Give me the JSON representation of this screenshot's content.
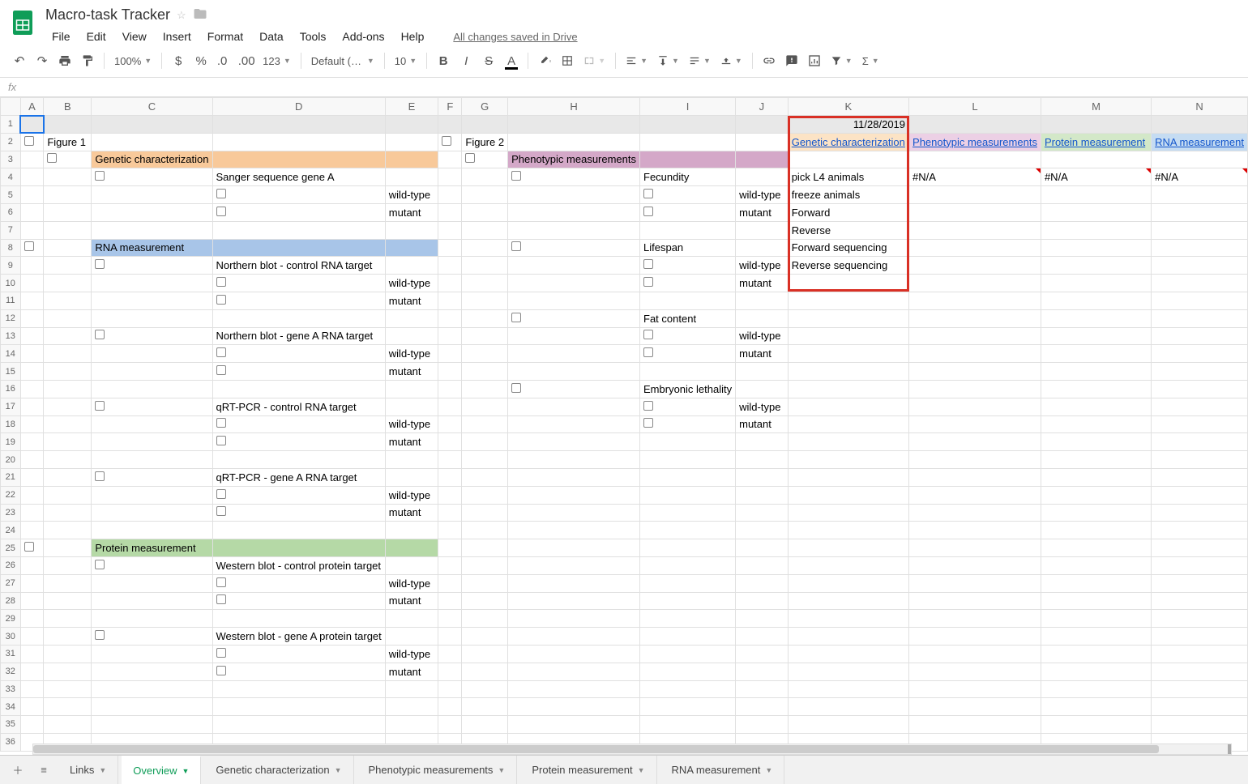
{
  "header": {
    "title": "Macro-task Tracker",
    "save_status": "All changes saved in Drive"
  },
  "menubar": [
    "File",
    "Edit",
    "View",
    "Insert",
    "Format",
    "Data",
    "Tools",
    "Add-ons",
    "Help"
  ],
  "toolbar": {
    "zoom": "100%",
    "font": "Default (Ari...",
    "font_size": "10"
  },
  "formula_bar": {
    "fx": "fx",
    "value": ""
  },
  "columns": [
    "A",
    "B",
    "C",
    "D",
    "E",
    "F",
    "G",
    "H",
    "I",
    "J",
    "K",
    "L",
    "M",
    "N"
  ],
  "sheet": {
    "row1": {
      "K": "11/28/2019"
    },
    "row2": {
      "B": "Figure 1",
      "G": "Figure 2",
      "K": "Genetic characterization",
      "L": "Phenotypic measurements",
      "M": "Protein measurement",
      "N": "RNA measurement"
    },
    "row3": {
      "C": "Genetic characterization",
      "H": "Phenotypic measurements"
    },
    "row4": {
      "D": "Sanger sequence gene A",
      "I": "Fecundity",
      "K": "pick L4 animals",
      "L": "#N/A",
      "M": "#N/A",
      "N": "#N/A"
    },
    "row5": {
      "E": "wild-type",
      "J": "wild-type",
      "K": "freeze animals"
    },
    "row6": {
      "E": "mutant",
      "J": "mutant",
      "K": "Forward"
    },
    "row7": {
      "K": "Reverse"
    },
    "row8": {
      "C": "RNA measurement",
      "I": "Lifespan",
      "K": "Forward sequencing"
    },
    "row9": {
      "D": "Northern blot - control RNA target",
      "J": "wild-type",
      "K": "Reverse sequencing"
    },
    "row10": {
      "E": "wild-type",
      "J": "mutant"
    },
    "row11": {
      "E": "mutant"
    },
    "row12": {
      "I": "Fat content"
    },
    "row13": {
      "D": "Northern blot - gene A RNA target",
      "J": "wild-type"
    },
    "row14": {
      "E": "wild-type",
      "J": "mutant"
    },
    "row15": {
      "E": "mutant"
    },
    "row16": {
      "I": "Embryonic lethality"
    },
    "row17": {
      "D": "qRT-PCR - control RNA target",
      "J": "wild-type"
    },
    "row18": {
      "E": "wild-type",
      "J": "mutant"
    },
    "row19": {
      "E": "mutant"
    },
    "row21": {
      "D": "qRT-PCR - gene A RNA target"
    },
    "row22": {
      "E": "wild-type"
    },
    "row23": {
      "E": "mutant"
    },
    "row25": {
      "C": "Protein measurement"
    },
    "row26": {
      "D": "Western blot - control protein target"
    },
    "row27": {
      "E": "wild-type"
    },
    "row28": {
      "E": "mutant"
    },
    "row30": {
      "D": "Western blot - gene A protein target"
    },
    "row31": {
      "E": "wild-type"
    },
    "row32": {
      "E": "mutant"
    }
  },
  "tabs": {
    "items": [
      "Links",
      "Overview",
      "Genetic characterization",
      "Phenotypic measurements",
      "Protein measurement",
      "RNA measurement"
    ],
    "active": "Overview"
  }
}
